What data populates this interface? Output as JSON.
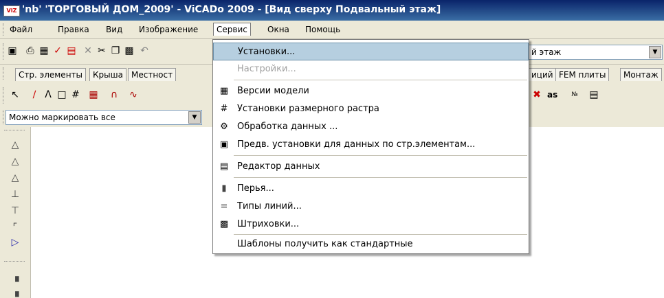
{
  "window": {
    "title": "'nb' 'ТОРГОВЫЙ ДОМ_2009' - ViCADo 2009 - [Вид сверху Подвальный этаж]",
    "icon_text": "VIZ"
  },
  "menubar": {
    "items": [
      {
        "label": "Файл"
      },
      {
        "label": "Правка"
      },
      {
        "label": "Вид"
      },
      {
        "label": "Изображение"
      },
      {
        "label": "Сервис"
      },
      {
        "label": "Окна"
      },
      {
        "label": "Помощь"
      }
    ]
  },
  "toolbar1": {
    "floor_combo_value": "й этаж"
  },
  "tabs": [
    {
      "label": "Стр. элементы"
    },
    {
      "label": "Крыша"
    },
    {
      "label": "Местност"
    },
    {
      "label": "иций"
    },
    {
      "label": "FEM плиты"
    },
    {
      "label": "Монтаж"
    }
  ],
  "toolbar2": {
    "as_label": "as"
  },
  "toolbar3": {
    "mark_combo_value": "Можно маркировать все"
  },
  "service_menu": {
    "items": [
      {
        "label": "Установки...",
        "icon": "",
        "state": "highlighted"
      },
      {
        "label": "Настройки...",
        "icon": "",
        "state": "disabled"
      },
      {
        "label": "Версии модели",
        "icon": "model-versions-icon",
        "state": "normal"
      },
      {
        "label": "Установки размерного растра",
        "icon": "grid-hash-icon",
        "state": "normal"
      },
      {
        "label": "Обработка данных ...",
        "icon": "data-processing-icon",
        "state": "normal"
      },
      {
        "label": "Предв. установки для данных по стр.элементам...",
        "icon": "preset-icon",
        "state": "normal"
      },
      {
        "label": "Редактор данных",
        "icon": "data-editor-icon",
        "state": "normal"
      },
      {
        "label": "Перья...",
        "icon": "pens-icon",
        "state": "normal"
      },
      {
        "label": "Типы линий...",
        "icon": "line-types-icon",
        "state": "normal"
      },
      {
        "label": "Штриховки...",
        "icon": "hatching-icon",
        "state": "normal"
      },
      {
        "label": "Шаблоны получить как стандартные",
        "icon": "",
        "state": "normal"
      }
    ]
  },
  "colors": {
    "title_bar": "#0a246a",
    "highlight": "#b6cfe0",
    "disabled_text": "#a0a0a0"
  }
}
